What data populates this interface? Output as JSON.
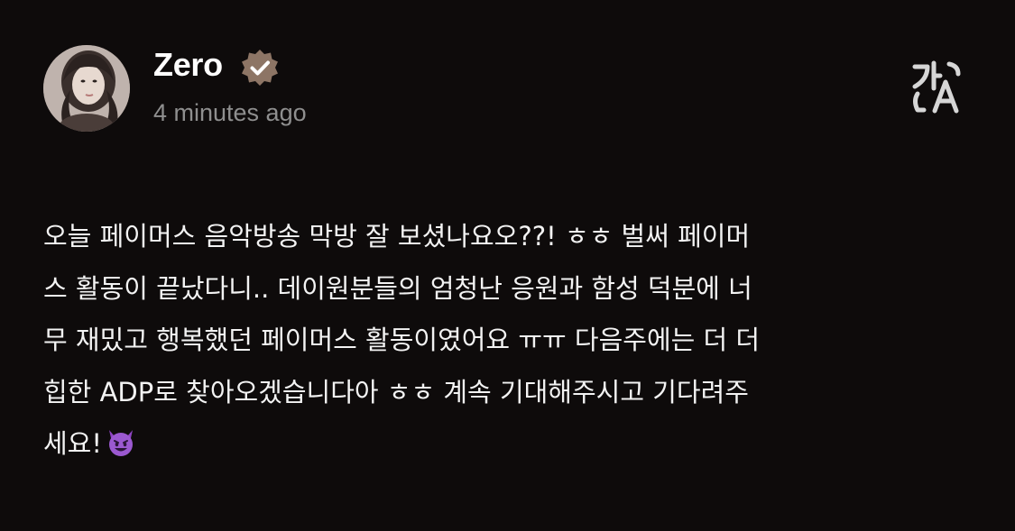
{
  "post": {
    "author_name": "Zero",
    "timestamp": "4 minutes ago",
    "verified": true,
    "body_lines": [
      "오늘 페이머스 음악방송 막방 잘 보셨나요오??! ㅎㅎ 벌써 페이머",
      "스 활동이 끝났다니.. 데이원분들의 엄청난 응원과 함성 덕분에 너",
      "무 재밌고 행복했던 페이머스 활동이였어요 ㅠㅠ 다음주에는 더 더",
      "힙한 ADP로 찾아오겠습니다아 ㅎㅎ 계속 기대해주시고 기다려주",
      "세요!"
    ],
    "trailing_emoji": "smiling-face-with-horns"
  },
  "icons": {
    "verified": "verified-badge-icon",
    "translate": "translate-icon"
  },
  "colors": {
    "background": "#0e0b0b",
    "text": "#f3f3f3",
    "muted": "#8f8f8f",
    "badge": "#8d7565",
    "emoji": "#9b59d0"
  }
}
